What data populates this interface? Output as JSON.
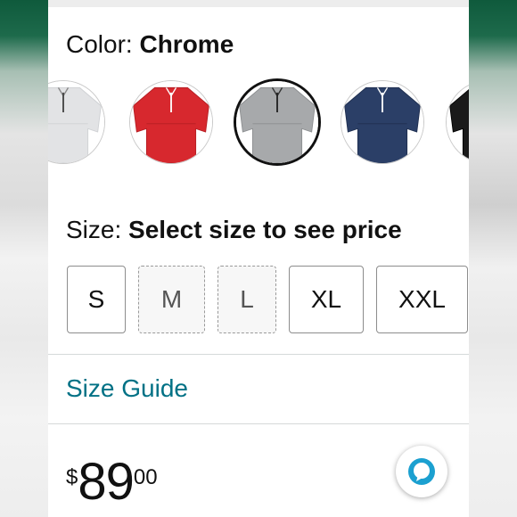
{
  "color_section": {
    "label": "Color: ",
    "selected_value": "Chrome"
  },
  "swatches": [
    {
      "name": "light-gray",
      "color": "#e2e3e5",
      "selected": false
    },
    {
      "name": "red",
      "color": "#d7282e",
      "selected": false
    },
    {
      "name": "chrome",
      "color": "#a7a9ab",
      "selected": true
    },
    {
      "name": "navy",
      "color": "#2b3f67",
      "selected": false
    },
    {
      "name": "black",
      "color": "#1a1a1a",
      "selected": false
    }
  ],
  "size_section": {
    "label": "Size: ",
    "prompt": "Select size to see price"
  },
  "sizes": [
    {
      "label": "S",
      "available": true
    },
    {
      "label": "M",
      "available": false
    },
    {
      "label": "L",
      "available": false
    },
    {
      "label": "XL",
      "available": true
    },
    {
      "label": "XXL",
      "available": true
    }
  ],
  "size_guide": {
    "label": "Size Guide"
  },
  "price": {
    "symbol": "$",
    "whole": "89",
    "fraction": "00"
  },
  "colors": {
    "link": "#007185",
    "alexa_ring": "#1ba0d0"
  },
  "icons": {
    "assistant": "alexa-icon"
  }
}
